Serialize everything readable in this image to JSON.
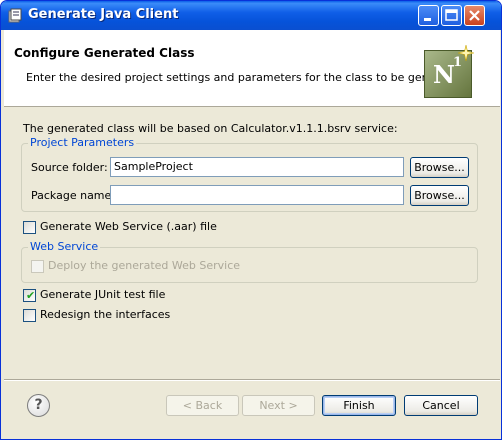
{
  "window": {
    "title": "Generate Java Client"
  },
  "header": {
    "title": "Configure Generated Class",
    "description": "Enter the desired project settings and parameters for the class to be generated",
    "logo_letter": "N",
    "logo_superscript": "1"
  },
  "info_text": "The generated class will be based on Calculator.v1.1.1.bsrv service:",
  "project_parameters": {
    "group_label": "Project Parameters",
    "source_folder_label": "Source folder:",
    "source_folder_value": "SampleProject",
    "source_folder_browse": "Browse...",
    "package_name_label": "Package name:",
    "package_name_value": "",
    "package_name_browse": "Browse..."
  },
  "generate_web_service": {
    "label": "Generate Web Service (.aar) file",
    "checked": false
  },
  "web_service": {
    "group_label": "Web Service",
    "deploy_label": "Deploy the generated Web Service",
    "deploy_checked": false,
    "deploy_enabled": false
  },
  "generate_junit": {
    "label": "Generate JUnit test file",
    "checked": true
  },
  "redesign_interfaces": {
    "label": "Redesign the interfaces",
    "checked": false
  },
  "buttons": {
    "help": "?",
    "back": "< Back",
    "next": "Next >",
    "finish": "Finish",
    "cancel": "Cancel"
  },
  "colors": {
    "titlebar": "#0653da",
    "dialog_bg": "#ece9d8",
    "group_label": "#0046d5",
    "check_mark": "#21a121"
  }
}
